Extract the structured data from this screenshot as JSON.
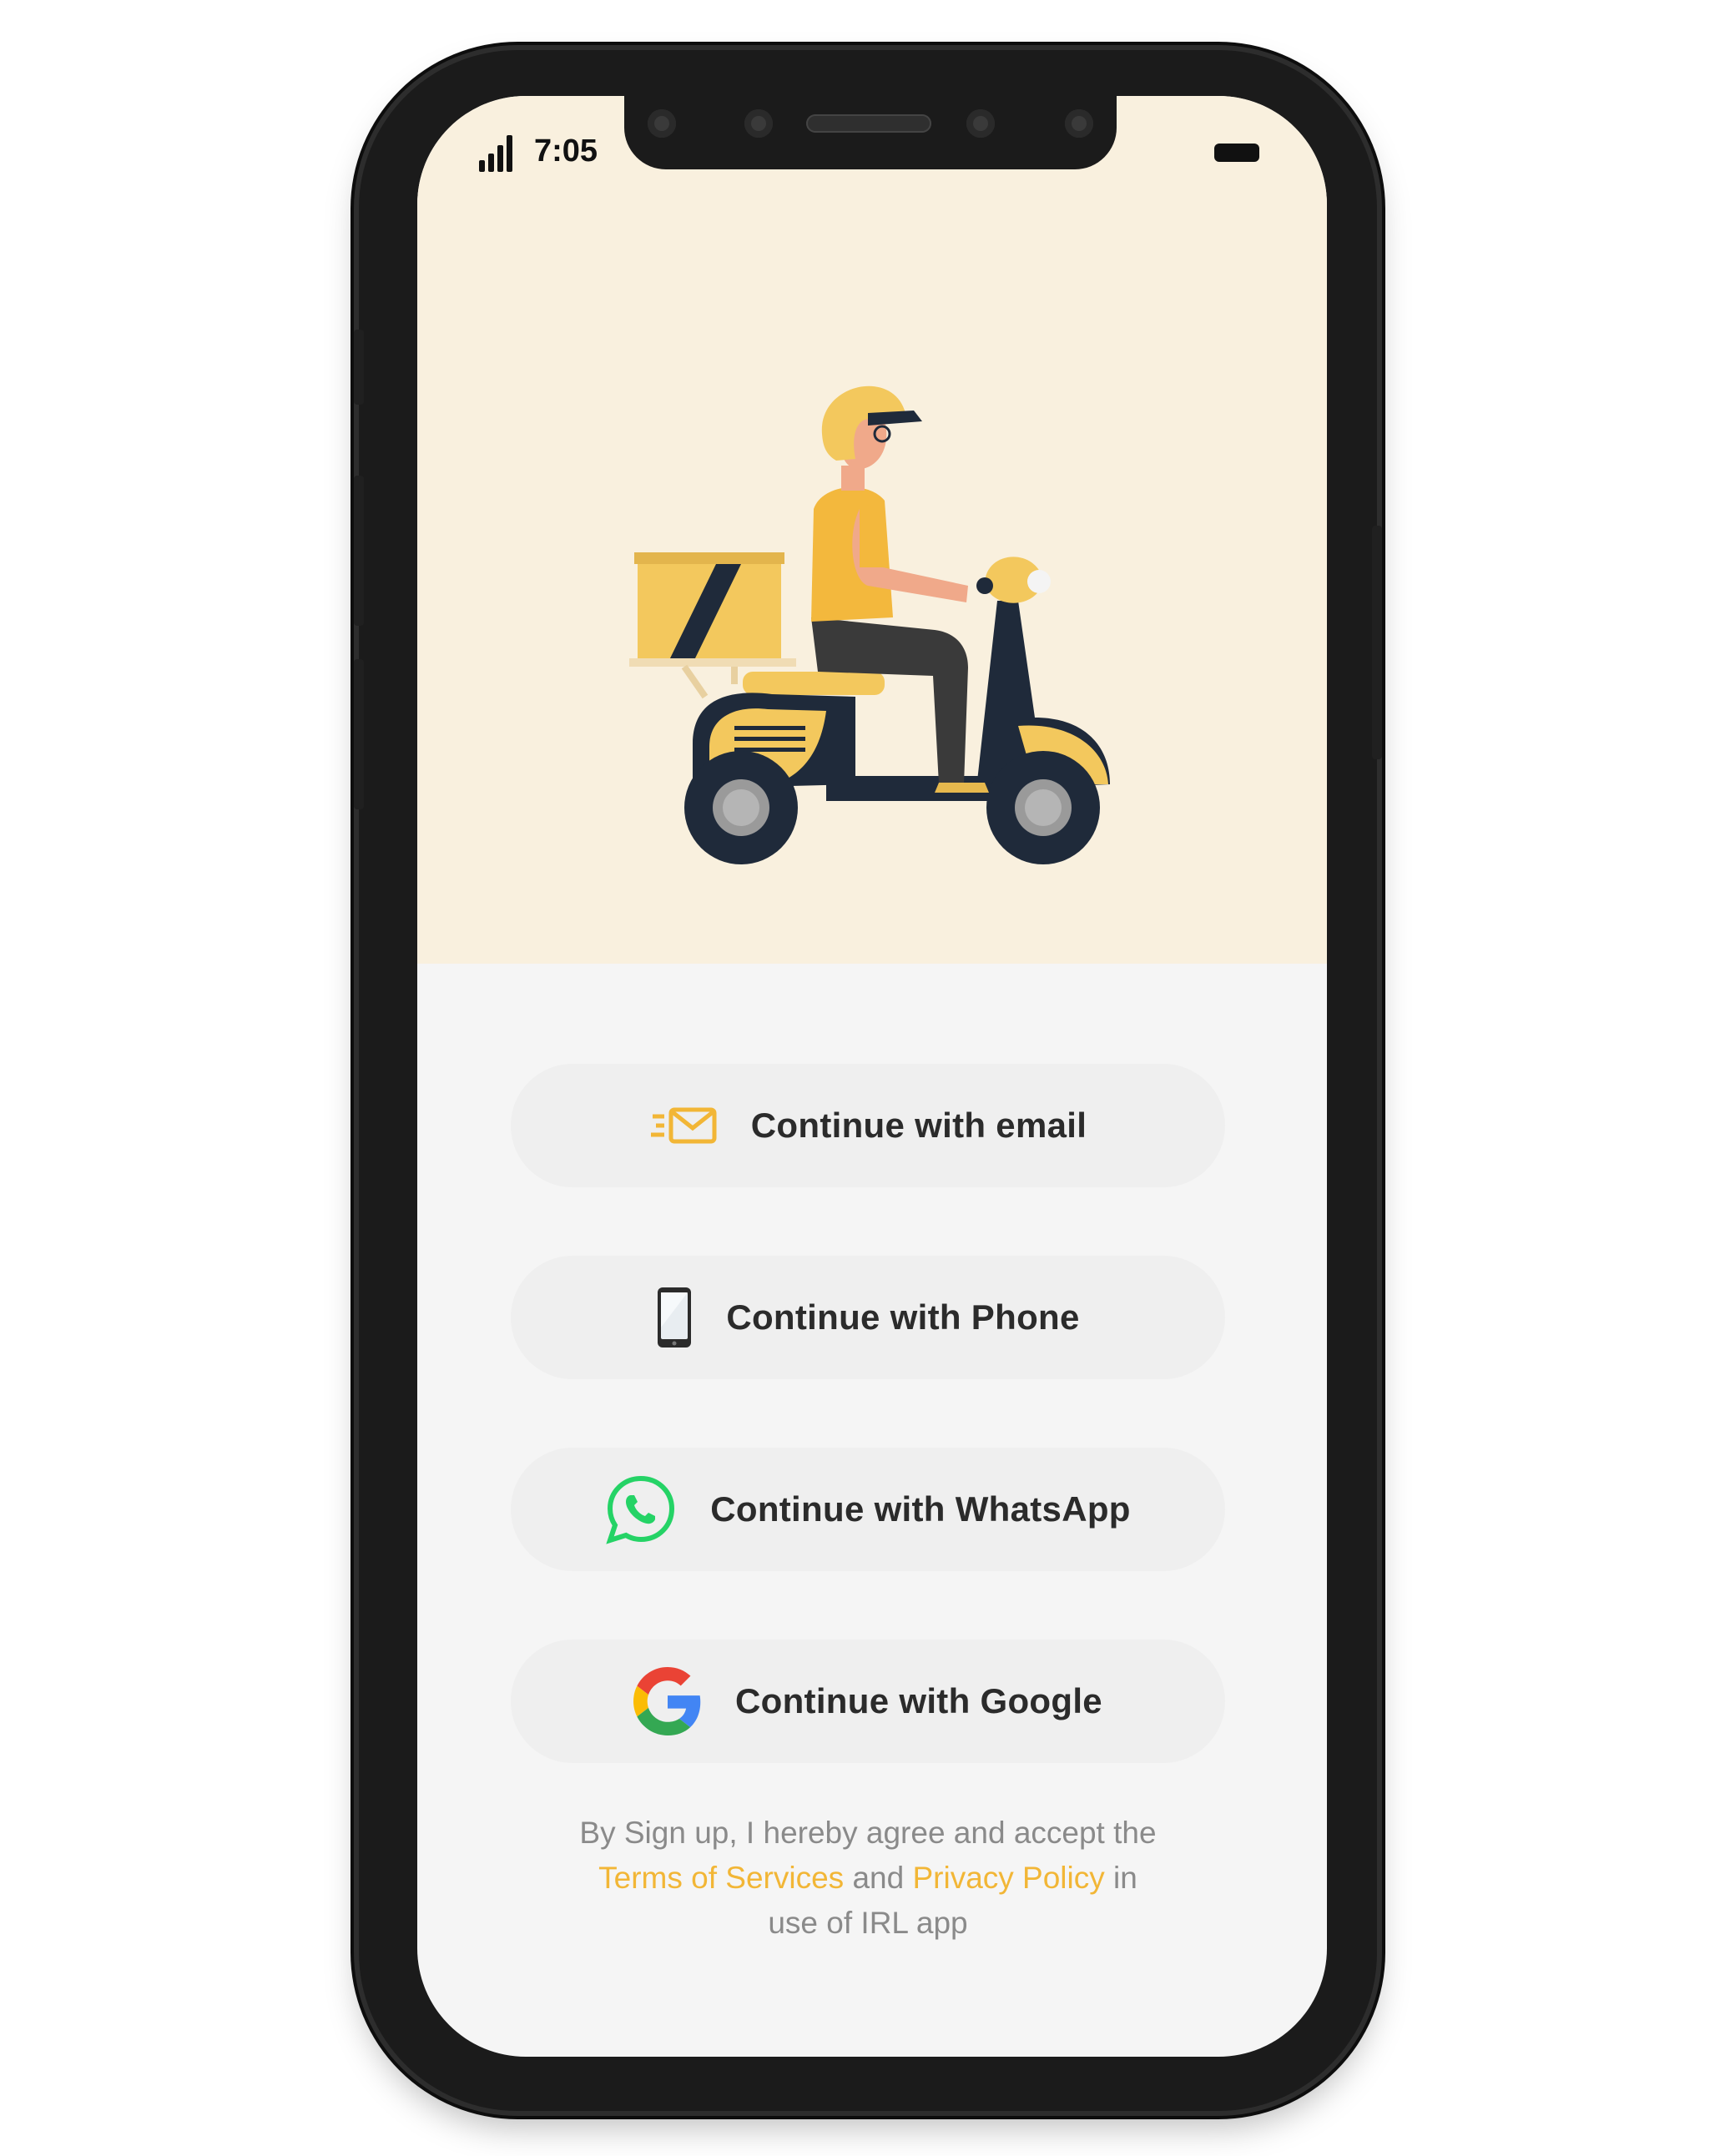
{
  "status_bar": {
    "time": "7:05"
  },
  "buttons": [
    {
      "label": "Continue with email",
      "icon": "email-icon"
    },
    {
      "label": "Continue with Phone",
      "icon": "phone-icon"
    },
    {
      "label": "Continue with WhatsApp",
      "icon": "whatsapp-icon"
    },
    {
      "label": "Continue with Google",
      "icon": "google-icon"
    }
  ],
  "terms": {
    "prefix": "By Sign up, I hereby agree and accept the",
    "terms_link": "Terms of Services",
    "and": "and",
    "privacy_link": "Privacy Policy",
    "suffix_in": "in",
    "suffix_line": "use of IRL app"
  },
  "illustration": "delivery-scooter-rider",
  "colors": {
    "accent": "#f2b636",
    "hero_background": "#f9f0de",
    "screen_background": "#f5f5f5",
    "button_background": "#efefef",
    "text_dark": "#2b2b2b",
    "text_muted": "#8a8a8a",
    "whatsapp_green": "#25d366"
  }
}
